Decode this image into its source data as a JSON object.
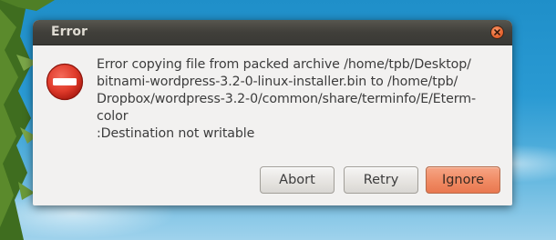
{
  "dialog": {
    "title": "Error",
    "message": "Error copying file from packed archive /home/tpb/Desktop/\nbitnami-wordpress-3.2-0-linux-installer.bin to /home/tpb/\nDropbox/wordpress-3.2-0/common/share/terminfo/E/Eterm-\ncolor\n:Destination not writable",
    "icon": "error-icon",
    "buttons": {
      "abort": "Abort",
      "retry": "Retry",
      "ignore": "Ignore"
    }
  },
  "colors": {
    "titlebar": "#3f3e39",
    "dialog_bg": "#f2f1f0",
    "default_button": "#f08a63",
    "close_button": "#ea6a35",
    "error_icon": "#df3a2a"
  }
}
